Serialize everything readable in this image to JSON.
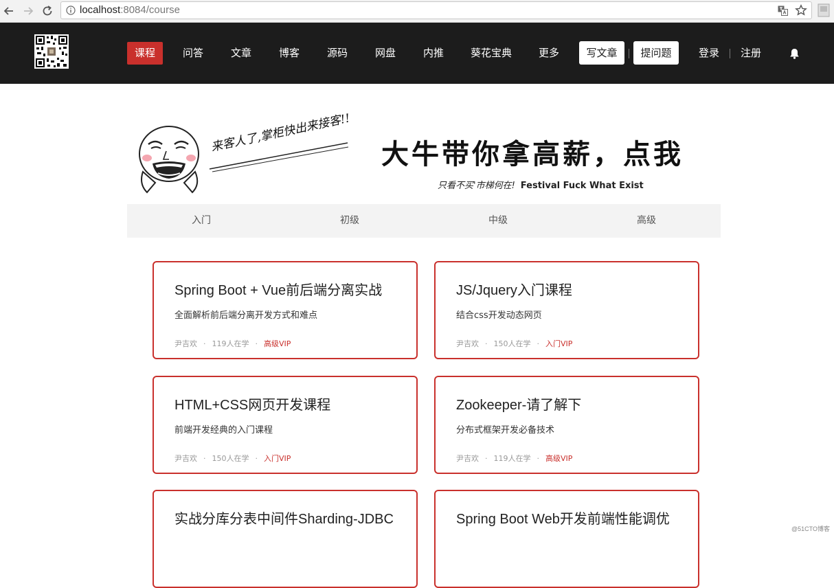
{
  "browser": {
    "url_host": "localhost",
    "url_rest": ":8084/course"
  },
  "header": {
    "nav": [
      {
        "label": "课程",
        "active": true
      },
      {
        "label": "问答"
      },
      {
        "label": "文章"
      },
      {
        "label": "博客"
      },
      {
        "label": "源码"
      },
      {
        "label": "网盘"
      },
      {
        "label": "内推"
      },
      {
        "label": "葵花宝典"
      },
      {
        "label": "更多"
      }
    ],
    "write_article": "写文章",
    "ask_question": "提问题",
    "login": "登录",
    "register": "注册",
    "accent_color": "#c9302c"
  },
  "banner": {
    "slogan": "来客人了,掌柜快出来接客!!",
    "title": "大牛带你拿高薪，点我",
    "sub_cn": "只看不买'市梯何在!",
    "sub_en": "Festival Fuck What Exist"
  },
  "levels": [
    "入门",
    "初级",
    "中级",
    "高级"
  ],
  "courses": [
    {
      "title": "Spring Boot + Vue前后端分离实战",
      "desc": "全面解析前后端分离开发方式和难点",
      "author": "尹吉欢",
      "students": "119人在学",
      "vip": "高级VIP"
    },
    {
      "title": "JS/Jquery入门课程",
      "desc": "结合css开发动态网页",
      "author": "尹吉欢",
      "students": "150人在学",
      "vip": "入门VIP"
    },
    {
      "title": "HTML+CSS网页开发课程",
      "desc": "前端开发经典的入门课程",
      "author": "尹吉欢",
      "students": "150人在学",
      "vip": "入门VIP"
    },
    {
      "title": "Zookeeper-请了解下",
      "desc": "分布式框架开发必备技术",
      "author": "尹吉欢",
      "students": "119人在学",
      "vip": "高级VIP"
    },
    {
      "title": "实战分库分表中间件Sharding-JDBC",
      "desc": "",
      "author": "",
      "students": "",
      "vip": ""
    },
    {
      "title": "Spring Boot Web开发前端性能调优",
      "desc": "",
      "author": "",
      "students": "",
      "vip": ""
    }
  ],
  "meta_separator": "·",
  "watermark": "@51CTO博客"
}
